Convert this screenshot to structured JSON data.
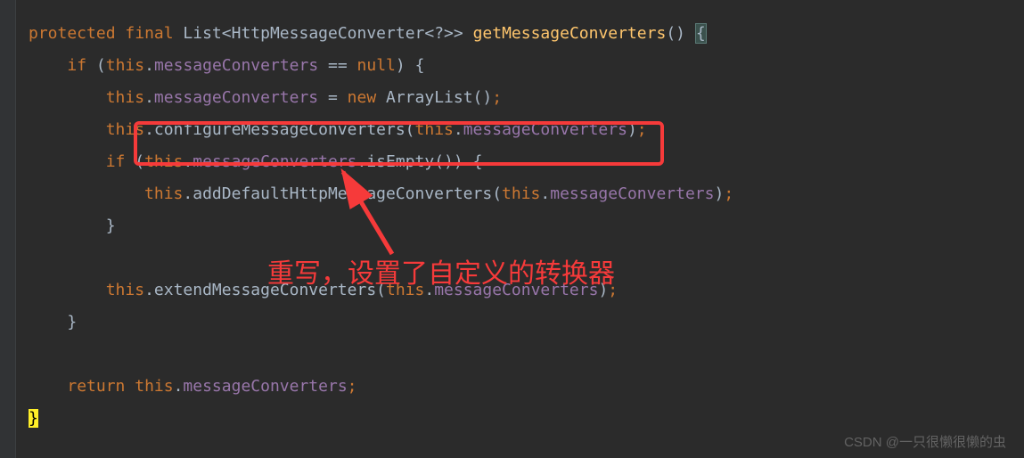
{
  "code": {
    "line1": {
      "modifier": "protected",
      "final": "final",
      "type": "List",
      "generic_open": "<",
      "generic_type": "HttpMessageConverter",
      "generic_inner": "<?>",
      "generic_close": ">",
      "method": "getMessageConverters",
      "parens": "()",
      "brace": "{"
    },
    "line2": {
      "if": "if",
      "paren_open": "(",
      "this": "this",
      "dot": ".",
      "field": "messageConverters",
      "op": " == ",
      "null": "null",
      "paren_close": ")",
      "brace": " {"
    },
    "line3": {
      "this": "this",
      "dot": ".",
      "field": "messageConverters",
      "op": " = ",
      "new": "new",
      "type": " ArrayList",
      "parens": "()",
      "semi": ";"
    },
    "line4": {
      "this1": "this",
      "dot1": ".",
      "method": "configureMessageConverters",
      "paren_open": "(",
      "this2": "this",
      "dot2": ".",
      "field": "messageConverters",
      "paren_close": ")",
      "semi": ";"
    },
    "line5": {
      "if": "if",
      "paren_open": " (",
      "this": "this",
      "dot1": ".",
      "field": "messageConverters",
      "dot2": ".",
      "method": "isEmpty",
      "parens": "()",
      "paren_close": ")",
      "brace": " {"
    },
    "line6": {
      "this1": "this",
      "dot1": ".",
      "method": "addDefaultHttpMessageConverters",
      "paren_open": "(",
      "this2": "this",
      "dot2": ".",
      "field": "messageConverters",
      "paren_close": ")",
      "semi": ";"
    },
    "line7": {
      "brace": "}"
    },
    "line9": {
      "this1": "this",
      "dot1": ".",
      "method": "extendMessageConverters",
      "paren_open": "(",
      "this2": "this",
      "dot2": ".",
      "field": "messageConverters",
      "paren_close": ")",
      "semi": ";"
    },
    "line10": {
      "brace": "}"
    },
    "line12": {
      "return": "return",
      "this": " this",
      "dot": ".",
      "field": "messageConverters",
      "semi": ";"
    },
    "line13": {
      "brace": "}"
    }
  },
  "annotation": "重写，设置了自定义的转换器",
  "watermark": "CSDN @一只很懒很懒的虫"
}
